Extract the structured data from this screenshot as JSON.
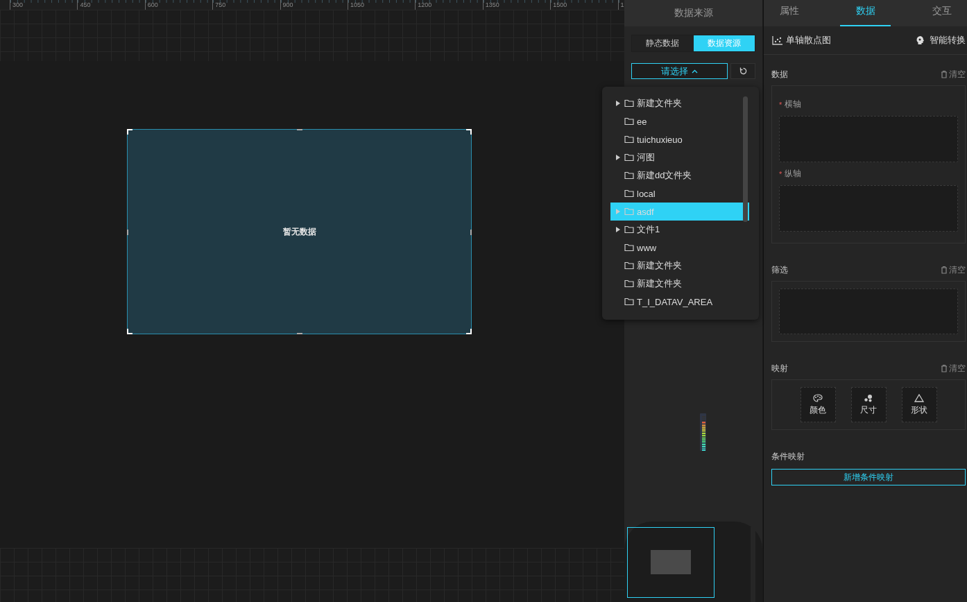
{
  "canvas": {
    "ruler_labels": [
      "300",
      "450",
      "600",
      "750",
      "900",
      "1050",
      "1200",
      "1350",
      "1500",
      "1"
    ],
    "component": {
      "empty_text": "暂无数据",
      "selected": true
    }
  },
  "data_source_panel": {
    "title": "数据来源",
    "modes": [
      {
        "label": "静态数据",
        "selected": false
      },
      {
        "label": "数据资源",
        "selected": true
      }
    ],
    "select": {
      "label": "请选择",
      "expanded": true
    },
    "tree": [
      {
        "label": "新建文件夹",
        "has_children": true,
        "selected": false
      },
      {
        "label": "ee",
        "has_children": false,
        "selected": false
      },
      {
        "label": "tuichuxieuo",
        "has_children": false,
        "selected": false
      },
      {
        "label": "河图",
        "has_children": true,
        "selected": false
      },
      {
        "label": "新建dd文件夹",
        "has_children": false,
        "selected": false
      },
      {
        "label": "local",
        "has_children": false,
        "selected": false
      },
      {
        "label": "asdf",
        "has_children": true,
        "selected": true
      },
      {
        "label": "文件1",
        "has_children": true,
        "selected": false
      },
      {
        "label": "www",
        "has_children": false,
        "selected": false
      },
      {
        "label": "新建文件夹",
        "has_children": false,
        "selected": false
      },
      {
        "label": "新建文件夹",
        "has_children": false,
        "selected": false
      },
      {
        "label": "T_I_DATAV_AREA",
        "has_children": false,
        "selected": false
      }
    ]
  },
  "config_panel": {
    "tabs": [
      {
        "label": "属性",
        "selected": false
      },
      {
        "label": "数据",
        "selected": true
      },
      {
        "label": "交互",
        "selected": false
      }
    ],
    "chart_type": "单轴散点图",
    "smart_convert": "智能转换",
    "sections": [
      {
        "kind": "fields",
        "title": "数据",
        "clear": "清空",
        "fields": [
          {
            "label": "横轴",
            "required_mark": "*"
          },
          {
            "label": "纵轴",
            "required_mark": "*"
          }
        ]
      },
      {
        "kind": "dropzone",
        "title": "筛选",
        "clear": "清空"
      },
      {
        "kind": "mapping",
        "title": "映射",
        "clear": "清空",
        "items": [
          {
            "label": "颜色",
            "kind": "palette"
          },
          {
            "label": "尺寸",
            "kind": "bubbles"
          },
          {
            "label": "形状",
            "kind": "triangle"
          }
        ]
      },
      {
        "kind": "button",
        "title": "条件映射",
        "button": "新增条件映射"
      }
    ]
  }
}
